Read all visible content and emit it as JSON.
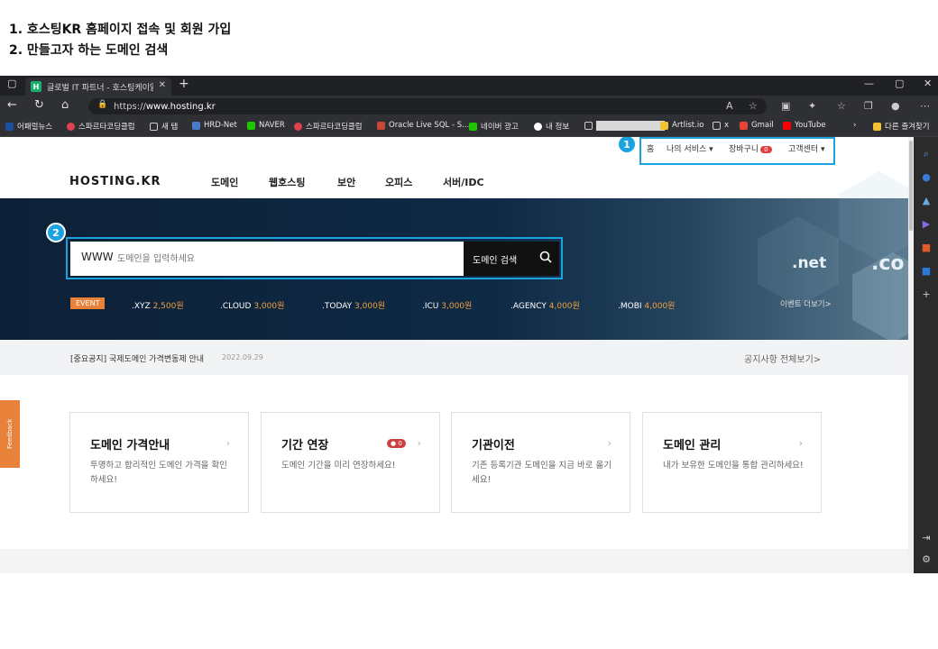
{
  "instructions": [
    "1. 호스팅KR 홈페이지 접속 및 회원 가입",
    "2. 만들고자 하는 도메인 검색"
  ],
  "browser": {
    "tab_title": "글로벌 IT 파트너 - 호스팅케이알",
    "favicon_letter": "H",
    "url_prefix": "https://",
    "url_host": "www.hosting.kr",
    "bookmarks": [
      "어패럴뉴스",
      "스파르타코딩클럽",
      "새 탭",
      "HRD-Net",
      "NAVER",
      "스파르타코딩클럽",
      "Oracle Live SQL - S...",
      "네이버 광고",
      "내 정보",
      "Artlist.io",
      "x",
      "Gmail",
      "YouTube"
    ],
    "other_favorites": "다른 즐겨찾기"
  },
  "site": {
    "util_nav": {
      "home": "홈",
      "my_services": "나의 서비스",
      "cart": "장바구니",
      "cart_count": "0",
      "support": "고객센터"
    },
    "logo": "HOSTING.KR",
    "gnb": [
      "도메인",
      "웹호스팅",
      "보안",
      "오피스",
      "서버/IDC"
    ],
    "search": {
      "prefix": "WWW",
      "placeholder": "도메인을 입력하세요",
      "button": "도메인 검색"
    },
    "event_label": "EVENT",
    "tld_prices": [
      {
        "tld": ".XYZ",
        "price": "2,500원"
      },
      {
        "tld": ".CLOUD",
        "price": "3,000원"
      },
      {
        "tld": ".TODAY",
        "price": "3,000원"
      },
      {
        "tld": ".ICU",
        "price": "3,000원"
      },
      {
        "tld": ".AGENCY",
        "price": "4,000원"
      },
      {
        "tld": ".MOBI",
        "price": "4,000원"
      }
    ],
    "event_more": "이벤트 더보기>",
    "hero_text": {
      "net": ".net",
      "co": ".co"
    },
    "notice": {
      "title": "[중요공지] 국제도메인 가격변동제 안내",
      "date": "2022.09.29",
      "more": "공지사항 전체보기>"
    },
    "cards": [
      {
        "title": "도메인 가격안내",
        "desc": "투명하고 합리적인 도메인 가격을 확인하세요!"
      },
      {
        "title": "기간 연장",
        "desc": "도메인 기간을 미리 연장하세요!",
        "badge": "0"
      },
      {
        "title": "기관이전",
        "desc": "기존 등록기관 도메인을 지금 바로 옮기세요!"
      },
      {
        "title": "도메인 관리",
        "desc": "내가 보유한 도메인을 통합 관리하세요!"
      }
    ],
    "feedback": "Feedback"
  },
  "annotations": {
    "step1": "1",
    "step2": "2"
  },
  "colors": {
    "highlight": "#1ba3e0",
    "hero_bg": "#0f2a45",
    "event": "#e8823a",
    "price": "#f0a040"
  }
}
